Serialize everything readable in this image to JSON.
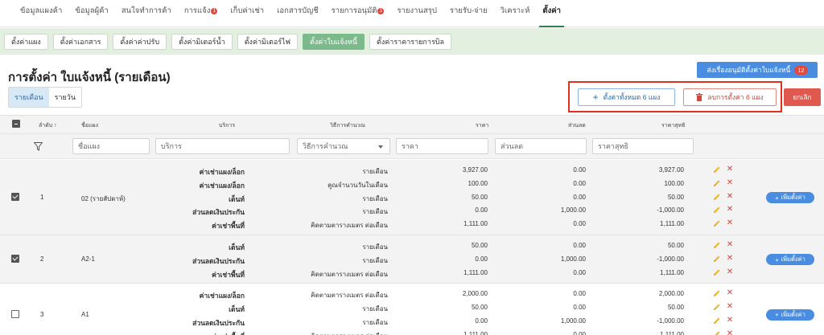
{
  "topnav": {
    "items": [
      {
        "label": "ข้อมูลแผงค้า",
        "badge": ""
      },
      {
        "label": "ข้อมูลผู้ค้า",
        "badge": ""
      },
      {
        "label": "สนใจทำการค้า",
        "badge": ""
      },
      {
        "label": "การแจ้ง",
        "badge": "1"
      },
      {
        "label": "เก็บค่าเช่า",
        "badge": ""
      },
      {
        "label": "เอกสารบัญชี",
        "badge": ""
      },
      {
        "label": "รายการอนุมัติ",
        "badge": "1"
      },
      {
        "label": "รายงานสรุป",
        "badge": ""
      },
      {
        "label": "รายรับ-จ่าย",
        "badge": ""
      },
      {
        "label": "วิเคราะห์",
        "badge": ""
      },
      {
        "label": "ตั้งค่า",
        "badge": ""
      }
    ],
    "active_index": 10
  },
  "subnav": {
    "items": [
      "ตั้งค่าแผง",
      "ตั้งค่าเอกสาร",
      "ตั้งค่าค่าปรับ",
      "ตั้งค่ามิเตอร์น้ำ",
      "ตั้งค่ามิเตอร์ไฟ",
      "ตั้งค่าใบแจ้งหนี้",
      "ตั้งค่าราคารายการบิล"
    ],
    "active_index": 5
  },
  "page": {
    "title": "การตั้งค่า ใบแจ้งหนี้ (รายเดือน)",
    "send_button": "ส่งเรื่องอนุมัติตั้งค่าใบแจ้งหนี้",
    "send_count": "12",
    "toggle": [
      "รายเดือน",
      "รายวัน"
    ],
    "set_all_button": "ตั้งค่าทั้งหมด 6 แผง",
    "delete_all_button": "ลบการตั้งค่า 6 แผง",
    "cancel_button": "ยกเลิก"
  },
  "table": {
    "headers": {
      "order": "ลำดับ ↑",
      "stall": "ชื่อแผง",
      "service": "บริการ",
      "method": "วิธีการคำนวณ",
      "price": "ราคา",
      "discount": "ส่วนลด",
      "net": "ราคาสุทธิ"
    },
    "filters": {
      "stall": "ชื่อแผง",
      "service": "บริการ",
      "method": "วิธีการคำนวณ",
      "price": "ราคา",
      "discount": "ส่วนลด",
      "net": "ราคาสุทธิ"
    },
    "add_label": "เพิ่มตั้งค่า",
    "groups": [
      {
        "no": "1",
        "stall": "02 (รายสัปดาห์)",
        "checked": true,
        "rows": [
          {
            "service": "ค่าเช่าแผง/ล็อก",
            "method": "รายเดือน",
            "price": "3,927.00",
            "discount": "0.00",
            "net": "3,927.00"
          },
          {
            "service": "ค่าเช่าแผง/ล็อก",
            "method": "คูณจำนวนวันในเดือน",
            "price": "100.00",
            "discount": "0.00",
            "net": "100.00"
          },
          {
            "service": "เต็นท์",
            "method": "รายเดือน",
            "price": "50.00",
            "discount": "0.00",
            "net": "50.00"
          },
          {
            "service": "ส่วนลดเงินประกัน",
            "method": "รายเดือน",
            "price": "0.00",
            "discount": "1,000.00",
            "net": "-1,000.00"
          },
          {
            "service": "ค่าเช่าพื้นที่",
            "method": "คิดตามตารางเมตร ต่อเดือน",
            "price": "1,111.00",
            "discount": "0.00",
            "net": "1,111.00"
          }
        ]
      },
      {
        "no": "2",
        "stall": "A2-1",
        "checked": true,
        "rows": [
          {
            "service": "เต็นท์",
            "method": "รายเดือน",
            "price": "50.00",
            "discount": "0.00",
            "net": "50.00"
          },
          {
            "service": "ส่วนลดเงินประกัน",
            "method": "รายเดือน",
            "price": "0.00",
            "discount": "1,000.00",
            "net": "-1,000.00"
          },
          {
            "service": "ค่าเช่าพื้นที่",
            "method": "คิดตามตารางเมตร ต่อเดือน",
            "price": "1,111.00",
            "discount": "0.00",
            "net": "1,111.00"
          }
        ]
      },
      {
        "no": "3",
        "stall": "A1",
        "checked": false,
        "rows": [
          {
            "service": "ค่าเช่าแผง/ล็อก",
            "method": "คิดตามตารางเมตร ต่อเดือน",
            "price": "2,000.00",
            "discount": "0.00",
            "net": "2,000.00"
          },
          {
            "service": "เต็นท์",
            "method": "รายเดือน",
            "price": "50.00",
            "discount": "0.00",
            "net": "50.00"
          },
          {
            "service": "ส่วนลดเงินประกัน",
            "method": "รายเดือน",
            "price": "0.00",
            "discount": "1,000.00",
            "net": "-1,000.00"
          },
          {
            "service": "ค่าเช่าพื้นที่",
            "method": "คิดตามตารางเมตร ต่อเดือน",
            "price": "1,111.00",
            "discount": "0.00",
            "net": "1,111.00"
          }
        ]
      }
    ]
  },
  "colors": {
    "accent_green": "#2e7d4f",
    "primary_blue": "#4a8de0",
    "danger_red": "#e0594e",
    "highlight_red": "#e0301e"
  }
}
